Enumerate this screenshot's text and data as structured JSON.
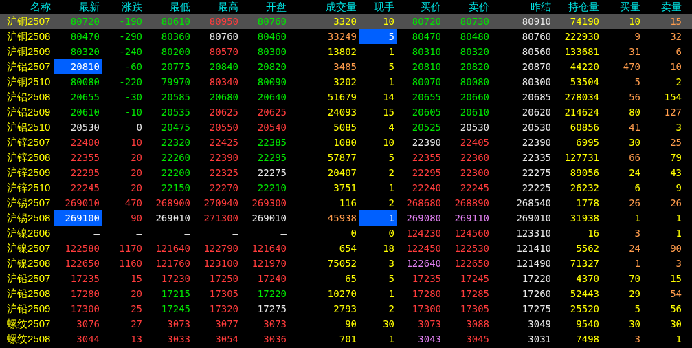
{
  "table": {
    "columns": [
      "名称",
      "最新",
      "涨跌",
      "最低",
      "最高",
      "开盘",
      "成交量",
      "现手",
      "买价",
      "卖价",
      "昨结",
      "持仓量",
      "买量",
      "卖量"
    ],
    "rows": [
      {
        "selected": true,
        "cells": [
          {
            "text": "沪铜2507",
            "kind": "name"
          },
          {
            "text": "80720",
            "kind": "down"
          },
          {
            "text": "-190",
            "kind": "down"
          },
          {
            "text": "80610",
            "kind": "down"
          },
          {
            "text": "80950",
            "kind": "up"
          },
          {
            "text": "80760",
            "kind": "down"
          },
          {
            "text": "3320",
            "kind": "yellow"
          },
          {
            "text": "10",
            "kind": "yellow"
          },
          {
            "text": "80720",
            "kind": "down"
          },
          {
            "text": "80730",
            "kind": "down"
          },
          {
            "text": "80910",
            "kind": "flat"
          },
          {
            "text": "74190",
            "kind": "yellow"
          },
          {
            "text": "10",
            "kind": "yellow"
          },
          {
            "text": "15",
            "kind": "orange"
          }
        ]
      },
      {
        "selected": false,
        "cells": [
          {
            "text": "沪铜2508",
            "kind": "name"
          },
          {
            "text": "80470",
            "kind": "down"
          },
          {
            "text": "-290",
            "kind": "down"
          },
          {
            "text": "80360",
            "kind": "down"
          },
          {
            "text": "80760",
            "kind": "flat"
          },
          {
            "text": "80460",
            "kind": "down"
          },
          {
            "text": "33249",
            "kind": "orange"
          },
          {
            "text": "5",
            "kind": "flash"
          },
          {
            "text": "80470",
            "kind": "down"
          },
          {
            "text": "80480",
            "kind": "down"
          },
          {
            "text": "80760",
            "kind": "flat"
          },
          {
            "text": "222930",
            "kind": "yellow"
          },
          {
            "text": "9",
            "kind": "orange"
          },
          {
            "text": "32",
            "kind": "orange"
          }
        ]
      },
      {
        "selected": false,
        "cells": [
          {
            "text": "沪铜2509",
            "kind": "name"
          },
          {
            "text": "80320",
            "kind": "down"
          },
          {
            "text": "-240",
            "kind": "down"
          },
          {
            "text": "80200",
            "kind": "down"
          },
          {
            "text": "80570",
            "kind": "up"
          },
          {
            "text": "80300",
            "kind": "down"
          },
          {
            "text": "13802",
            "kind": "yellow"
          },
          {
            "text": "1",
            "kind": "yellow"
          },
          {
            "text": "80310",
            "kind": "down"
          },
          {
            "text": "80320",
            "kind": "down"
          },
          {
            "text": "80560",
            "kind": "flat"
          },
          {
            "text": "133681",
            "kind": "yellow"
          },
          {
            "text": "31",
            "kind": "orange"
          },
          {
            "text": "6",
            "kind": "orange"
          }
        ]
      },
      {
        "selected": false,
        "cells": [
          {
            "text": "沪铝2507",
            "kind": "name"
          },
          {
            "text": "20810",
            "kind": "flash"
          },
          {
            "text": "-60",
            "kind": "down"
          },
          {
            "text": "20775",
            "kind": "down"
          },
          {
            "text": "20840",
            "kind": "down"
          },
          {
            "text": "20820",
            "kind": "down"
          },
          {
            "text": "3485",
            "kind": "orange"
          },
          {
            "text": "5",
            "kind": "yellow"
          },
          {
            "text": "20810",
            "kind": "down"
          },
          {
            "text": "20820",
            "kind": "down"
          },
          {
            "text": "20870",
            "kind": "flat"
          },
          {
            "text": "44220",
            "kind": "yellow"
          },
          {
            "text": "470",
            "kind": "orange"
          },
          {
            "text": "10",
            "kind": "orange"
          }
        ]
      },
      {
        "selected": false,
        "cells": [
          {
            "text": "沪铜2510",
            "kind": "name"
          },
          {
            "text": "80080",
            "kind": "down"
          },
          {
            "text": "-220",
            "kind": "down"
          },
          {
            "text": "79970",
            "kind": "down"
          },
          {
            "text": "80340",
            "kind": "up"
          },
          {
            "text": "80090",
            "kind": "down"
          },
          {
            "text": "3202",
            "kind": "yellow"
          },
          {
            "text": "1",
            "kind": "yellow"
          },
          {
            "text": "80070",
            "kind": "down"
          },
          {
            "text": "80080",
            "kind": "down"
          },
          {
            "text": "80300",
            "kind": "flat"
          },
          {
            "text": "53504",
            "kind": "yellow"
          },
          {
            "text": "5",
            "kind": "orange"
          },
          {
            "text": "2",
            "kind": "yellow"
          }
        ]
      },
      {
        "selected": false,
        "cells": [
          {
            "text": "沪铝2508",
            "kind": "name"
          },
          {
            "text": "20655",
            "kind": "down"
          },
          {
            "text": "-30",
            "kind": "down"
          },
          {
            "text": "20585",
            "kind": "down"
          },
          {
            "text": "20680",
            "kind": "down"
          },
          {
            "text": "20640",
            "kind": "down"
          },
          {
            "text": "51679",
            "kind": "yellow"
          },
          {
            "text": "14",
            "kind": "yellow"
          },
          {
            "text": "20655",
            "kind": "down"
          },
          {
            "text": "20660",
            "kind": "down"
          },
          {
            "text": "20685",
            "kind": "flat"
          },
          {
            "text": "278034",
            "kind": "yellow"
          },
          {
            "text": "56",
            "kind": "orange"
          },
          {
            "text": "154",
            "kind": "yellow"
          }
        ]
      },
      {
        "selected": false,
        "cells": [
          {
            "text": "沪铝2509",
            "kind": "name"
          },
          {
            "text": "20610",
            "kind": "down"
          },
          {
            "text": "-10",
            "kind": "down"
          },
          {
            "text": "20535",
            "kind": "down"
          },
          {
            "text": "20625",
            "kind": "up"
          },
          {
            "text": "20625",
            "kind": "up"
          },
          {
            "text": "24093",
            "kind": "yellow"
          },
          {
            "text": "15",
            "kind": "yellow"
          },
          {
            "text": "20605",
            "kind": "down"
          },
          {
            "text": "20610",
            "kind": "down"
          },
          {
            "text": "20620",
            "kind": "flat"
          },
          {
            "text": "214624",
            "kind": "yellow"
          },
          {
            "text": "80",
            "kind": "yellow"
          },
          {
            "text": "127",
            "kind": "orange"
          }
        ]
      },
      {
        "selected": false,
        "cells": [
          {
            "text": "沪铝2510",
            "kind": "name"
          },
          {
            "text": "20530",
            "kind": "flat"
          },
          {
            "text": "0",
            "kind": "flat"
          },
          {
            "text": "20475",
            "kind": "down"
          },
          {
            "text": "20550",
            "kind": "up"
          },
          {
            "text": "20540",
            "kind": "up"
          },
          {
            "text": "5085",
            "kind": "yellow"
          },
          {
            "text": "4",
            "kind": "yellow"
          },
          {
            "text": "20525",
            "kind": "down"
          },
          {
            "text": "20530",
            "kind": "flat"
          },
          {
            "text": "20530",
            "kind": "flat"
          },
          {
            "text": "60856",
            "kind": "yellow"
          },
          {
            "text": "41",
            "kind": "orange"
          },
          {
            "text": "3",
            "kind": "yellow"
          }
        ]
      },
      {
        "selected": false,
        "cells": [
          {
            "text": "沪锌2507",
            "kind": "name"
          },
          {
            "text": "22400",
            "kind": "up"
          },
          {
            "text": "10",
            "kind": "up"
          },
          {
            "text": "22320",
            "kind": "down"
          },
          {
            "text": "22425",
            "kind": "up"
          },
          {
            "text": "22385",
            "kind": "down"
          },
          {
            "text": "1080",
            "kind": "yellow"
          },
          {
            "text": "10",
            "kind": "yellow"
          },
          {
            "text": "22390",
            "kind": "flat"
          },
          {
            "text": "22405",
            "kind": "up"
          },
          {
            "text": "22390",
            "kind": "flat"
          },
          {
            "text": "6995",
            "kind": "yellow"
          },
          {
            "text": "30",
            "kind": "yellow"
          },
          {
            "text": "25",
            "kind": "orange"
          }
        ]
      },
      {
        "selected": false,
        "cells": [
          {
            "text": "沪锌2508",
            "kind": "name"
          },
          {
            "text": "22355",
            "kind": "up"
          },
          {
            "text": "20",
            "kind": "up"
          },
          {
            "text": "22260",
            "kind": "down"
          },
          {
            "text": "22390",
            "kind": "up"
          },
          {
            "text": "22295",
            "kind": "down"
          },
          {
            "text": "57877",
            "kind": "yellow"
          },
          {
            "text": "5",
            "kind": "yellow"
          },
          {
            "text": "22355",
            "kind": "up"
          },
          {
            "text": "22360",
            "kind": "up"
          },
          {
            "text": "22335",
            "kind": "flat"
          },
          {
            "text": "127731",
            "kind": "yellow"
          },
          {
            "text": "66",
            "kind": "orange"
          },
          {
            "text": "79",
            "kind": "yellow"
          }
        ]
      },
      {
        "selected": false,
        "cells": [
          {
            "text": "沪锌2509",
            "kind": "name"
          },
          {
            "text": "22295",
            "kind": "up"
          },
          {
            "text": "20",
            "kind": "up"
          },
          {
            "text": "22200",
            "kind": "down"
          },
          {
            "text": "22325",
            "kind": "up"
          },
          {
            "text": "22275",
            "kind": "flat"
          },
          {
            "text": "20407",
            "kind": "yellow"
          },
          {
            "text": "2",
            "kind": "yellow"
          },
          {
            "text": "22295",
            "kind": "up"
          },
          {
            "text": "22300",
            "kind": "up"
          },
          {
            "text": "22275",
            "kind": "flat"
          },
          {
            "text": "89056",
            "kind": "yellow"
          },
          {
            "text": "24",
            "kind": "yellow"
          },
          {
            "text": "43",
            "kind": "yellow"
          }
        ]
      },
      {
        "selected": false,
        "cells": [
          {
            "text": "沪锌2510",
            "kind": "name"
          },
          {
            "text": "22245",
            "kind": "up"
          },
          {
            "text": "20",
            "kind": "up"
          },
          {
            "text": "22150",
            "kind": "down"
          },
          {
            "text": "22270",
            "kind": "up"
          },
          {
            "text": "22210",
            "kind": "down"
          },
          {
            "text": "3751",
            "kind": "yellow"
          },
          {
            "text": "1",
            "kind": "yellow"
          },
          {
            "text": "22240",
            "kind": "up"
          },
          {
            "text": "22245",
            "kind": "up"
          },
          {
            "text": "22225",
            "kind": "flat"
          },
          {
            "text": "26232",
            "kind": "yellow"
          },
          {
            "text": "6",
            "kind": "yellow"
          },
          {
            "text": "9",
            "kind": "yellow"
          }
        ]
      },
      {
        "selected": false,
        "cells": [
          {
            "text": "沪锡2507",
            "kind": "name"
          },
          {
            "text": "269010",
            "kind": "up"
          },
          {
            "text": "470",
            "kind": "up"
          },
          {
            "text": "268900",
            "kind": "up"
          },
          {
            "text": "270940",
            "kind": "up"
          },
          {
            "text": "269300",
            "kind": "up"
          },
          {
            "text": "116",
            "kind": "yellow"
          },
          {
            "text": "2",
            "kind": "yellow"
          },
          {
            "text": "268680",
            "kind": "up"
          },
          {
            "text": "268890",
            "kind": "up"
          },
          {
            "text": "268540",
            "kind": "flat"
          },
          {
            "text": "1778",
            "kind": "yellow"
          },
          {
            "text": "26",
            "kind": "orange"
          },
          {
            "text": "26",
            "kind": "orange"
          }
        ]
      },
      {
        "selected": false,
        "cells": [
          {
            "text": "沪锡2508",
            "kind": "name"
          },
          {
            "text": "269100",
            "kind": "flash"
          },
          {
            "text": "90",
            "kind": "up"
          },
          {
            "text": "269010",
            "kind": "flat"
          },
          {
            "text": "271300",
            "kind": "up"
          },
          {
            "text": "269010",
            "kind": "flat"
          },
          {
            "text": "45938",
            "kind": "orange"
          },
          {
            "text": "1",
            "kind": "flash"
          },
          {
            "text": "269080",
            "kind": "pink"
          },
          {
            "text": "269110",
            "kind": "pink"
          },
          {
            "text": "269010",
            "kind": "flat"
          },
          {
            "text": "31938",
            "kind": "yellow"
          },
          {
            "text": "1",
            "kind": "yellow"
          },
          {
            "text": "1",
            "kind": "yellow"
          }
        ]
      },
      {
        "selected": false,
        "cells": [
          {
            "text": "沪镍2606",
            "kind": "name"
          },
          {
            "text": "—",
            "kind": "flat"
          },
          {
            "text": "—",
            "kind": "flat"
          },
          {
            "text": "—",
            "kind": "flat"
          },
          {
            "text": "—",
            "kind": "flat"
          },
          {
            "text": "—",
            "kind": "flat"
          },
          {
            "text": "0",
            "kind": "yellow"
          },
          {
            "text": "0",
            "kind": "yellow"
          },
          {
            "text": "124230",
            "kind": "up"
          },
          {
            "text": "124560",
            "kind": "up"
          },
          {
            "text": "123310",
            "kind": "flat"
          },
          {
            "text": "16",
            "kind": "yellow"
          },
          {
            "text": "3",
            "kind": "orange"
          },
          {
            "text": "1",
            "kind": "yellow"
          }
        ]
      },
      {
        "selected": false,
        "cells": [
          {
            "text": "沪镍2507",
            "kind": "name"
          },
          {
            "text": "122580",
            "kind": "up"
          },
          {
            "text": "1170",
            "kind": "up"
          },
          {
            "text": "121640",
            "kind": "up"
          },
          {
            "text": "122790",
            "kind": "up"
          },
          {
            "text": "121640",
            "kind": "up"
          },
          {
            "text": "654",
            "kind": "yellow"
          },
          {
            "text": "18",
            "kind": "yellow"
          },
          {
            "text": "122450",
            "kind": "up"
          },
          {
            "text": "122530",
            "kind": "up"
          },
          {
            "text": "121410",
            "kind": "flat"
          },
          {
            "text": "5562",
            "kind": "yellow"
          },
          {
            "text": "24",
            "kind": "orange"
          },
          {
            "text": "90",
            "kind": "orange"
          }
        ]
      },
      {
        "selected": false,
        "cells": [
          {
            "text": "沪镍2508",
            "kind": "name"
          },
          {
            "text": "122650",
            "kind": "up"
          },
          {
            "text": "1160",
            "kind": "up"
          },
          {
            "text": "121760",
            "kind": "up"
          },
          {
            "text": "123100",
            "kind": "up"
          },
          {
            "text": "121970",
            "kind": "up"
          },
          {
            "text": "75052",
            "kind": "yellow"
          },
          {
            "text": "3",
            "kind": "yellow"
          },
          {
            "text": "122640",
            "kind": "pink"
          },
          {
            "text": "122650",
            "kind": "up"
          },
          {
            "text": "121490",
            "kind": "flat"
          },
          {
            "text": "71327",
            "kind": "yellow"
          },
          {
            "text": "1",
            "kind": "orange"
          },
          {
            "text": "3",
            "kind": "orange"
          }
        ]
      },
      {
        "selected": false,
        "cells": [
          {
            "text": "沪铅2507",
            "kind": "name"
          },
          {
            "text": "17235",
            "kind": "up"
          },
          {
            "text": "15",
            "kind": "up"
          },
          {
            "text": "17230",
            "kind": "up"
          },
          {
            "text": "17250",
            "kind": "up"
          },
          {
            "text": "17240",
            "kind": "up"
          },
          {
            "text": "65",
            "kind": "yellow"
          },
          {
            "text": "5",
            "kind": "yellow"
          },
          {
            "text": "17235",
            "kind": "up"
          },
          {
            "text": "17245",
            "kind": "up"
          },
          {
            "text": "17220",
            "kind": "flat"
          },
          {
            "text": "4370",
            "kind": "yellow"
          },
          {
            "text": "70",
            "kind": "yellow"
          },
          {
            "text": "15",
            "kind": "yellow"
          }
        ]
      },
      {
        "selected": false,
        "cells": [
          {
            "text": "沪铅2508",
            "kind": "name"
          },
          {
            "text": "17280",
            "kind": "up"
          },
          {
            "text": "20",
            "kind": "up"
          },
          {
            "text": "17215",
            "kind": "down"
          },
          {
            "text": "17305",
            "kind": "up"
          },
          {
            "text": "17220",
            "kind": "down"
          },
          {
            "text": "10270",
            "kind": "yellow"
          },
          {
            "text": "1",
            "kind": "yellow"
          },
          {
            "text": "17280",
            "kind": "up"
          },
          {
            "text": "17285",
            "kind": "up"
          },
          {
            "text": "17260",
            "kind": "flat"
          },
          {
            "text": "52443",
            "kind": "yellow"
          },
          {
            "text": "29",
            "kind": "yellow"
          },
          {
            "text": "54",
            "kind": "orange"
          }
        ]
      },
      {
        "selected": false,
        "cells": [
          {
            "text": "沪铅2509",
            "kind": "name"
          },
          {
            "text": "17300",
            "kind": "up"
          },
          {
            "text": "25",
            "kind": "up"
          },
          {
            "text": "17245",
            "kind": "down"
          },
          {
            "text": "17320",
            "kind": "up"
          },
          {
            "text": "17275",
            "kind": "flat"
          },
          {
            "text": "2793",
            "kind": "yellow"
          },
          {
            "text": "2",
            "kind": "yellow"
          },
          {
            "text": "17300",
            "kind": "up"
          },
          {
            "text": "17305",
            "kind": "up"
          },
          {
            "text": "17275",
            "kind": "flat"
          },
          {
            "text": "25520",
            "kind": "yellow"
          },
          {
            "text": "5",
            "kind": "yellow"
          },
          {
            "text": "56",
            "kind": "yellow"
          }
        ]
      },
      {
        "selected": false,
        "cells": [
          {
            "text": "螺纹2507",
            "kind": "name"
          },
          {
            "text": "3076",
            "kind": "up"
          },
          {
            "text": "27",
            "kind": "up"
          },
          {
            "text": "3073",
            "kind": "up"
          },
          {
            "text": "3077",
            "kind": "up"
          },
          {
            "text": "3073",
            "kind": "up"
          },
          {
            "text": "90",
            "kind": "yellow"
          },
          {
            "text": "30",
            "kind": "yellow"
          },
          {
            "text": "3073",
            "kind": "up"
          },
          {
            "text": "3088",
            "kind": "up"
          },
          {
            "text": "3049",
            "kind": "flat"
          },
          {
            "text": "9540",
            "kind": "yellow"
          },
          {
            "text": "30",
            "kind": "yellow"
          },
          {
            "text": "30",
            "kind": "yellow"
          }
        ]
      },
      {
        "selected": false,
        "cells": [
          {
            "text": "螺纹2508",
            "kind": "name"
          },
          {
            "text": "3044",
            "kind": "up"
          },
          {
            "text": "13",
            "kind": "up"
          },
          {
            "text": "3033",
            "kind": "up"
          },
          {
            "text": "3054",
            "kind": "up"
          },
          {
            "text": "3036",
            "kind": "up"
          },
          {
            "text": "701",
            "kind": "yellow"
          },
          {
            "text": "1",
            "kind": "yellow"
          },
          {
            "text": "3043",
            "kind": "pink"
          },
          {
            "text": "3045",
            "kind": "up"
          },
          {
            "text": "3031",
            "kind": "flat"
          },
          {
            "text": "7498",
            "kind": "yellow"
          },
          {
            "text": "3",
            "kind": "orange"
          },
          {
            "text": "1",
            "kind": "yellow"
          }
        ]
      }
    ]
  }
}
